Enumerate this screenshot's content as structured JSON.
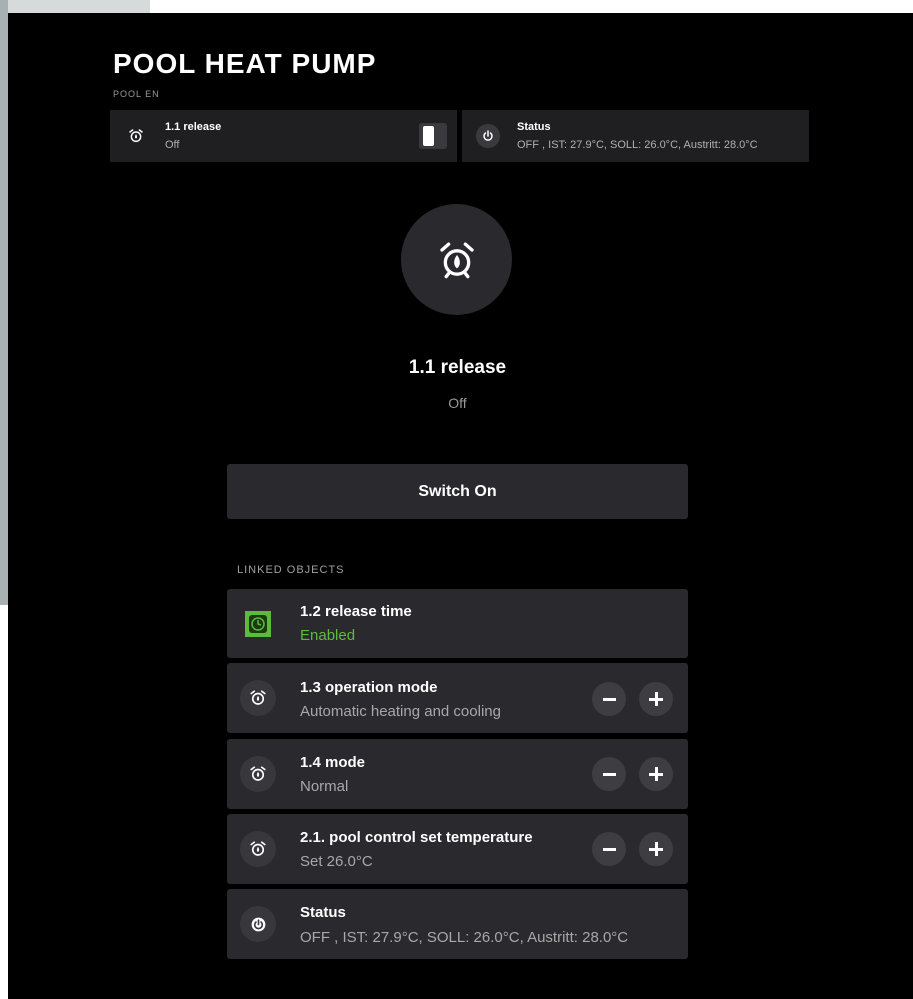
{
  "page": {
    "title": "POOL HEAT PUMP",
    "subtitle": "POOL EN"
  },
  "tiles": [
    {
      "title": "1.1 release",
      "value": "Off",
      "icon": "alarm-clock-icon",
      "control": "toggle"
    },
    {
      "title": "Status",
      "value": "OFF , IST: 27.9°C, SOLL: 26.0°C, Austritt: 28.0°C",
      "icon": "power-icon"
    }
  ],
  "hero": {
    "icon": "alarm-clock-icon",
    "title": "1.1 release",
    "value": "Off"
  },
  "action": {
    "label": "Switch On"
  },
  "linked": {
    "label": "LINKED OBJECTS",
    "items": [
      {
        "title": "1.2 release time",
        "value": "Enabled",
        "icon": "clock-icon",
        "accent": "#5dbb3a"
      },
      {
        "title": "1.3 operation mode",
        "value": "Automatic heating and cooling",
        "icon": "alarm-clock-icon",
        "stepper": true
      },
      {
        "title": "1.4 mode",
        "value": "Normal",
        "icon": "alarm-clock-icon",
        "stepper": true
      },
      {
        "title": "2.1. pool control set temperature",
        "value": "Set 26.0°C",
        "icon": "alarm-clock-icon",
        "stepper": true
      },
      {
        "title": "Status",
        "value": "OFF , IST: 27.9°C, SOLL: 26.0°C, Austritt: 28.0°C",
        "icon": "power-icon"
      }
    ]
  },
  "colors": {
    "background": "#000000",
    "tile": "#1f1f22",
    "row": "#2a2a2e",
    "accent_green": "#5dbb3a"
  }
}
